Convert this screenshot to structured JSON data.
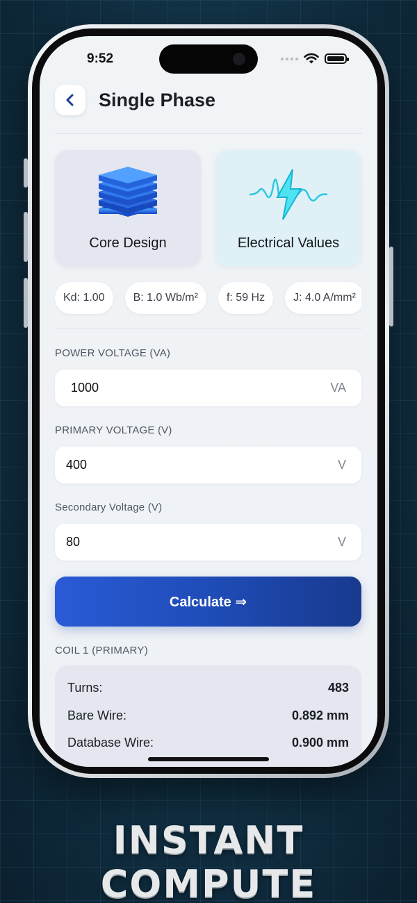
{
  "status": {
    "time": "9:52"
  },
  "header": {
    "title": "Single Phase",
    "back_icon": "chevron-left-icon"
  },
  "modes": [
    {
      "label": "Core Design",
      "icon": "core-stack-icon"
    },
    {
      "label": "Electrical Values",
      "icon": "lightning-wave-icon"
    }
  ],
  "chips": [
    "Kd: 1.00",
    "B: 1.0 Wb/m²",
    "f: 59 Hz",
    "J: 4.0 A/mm²"
  ],
  "fields": {
    "power": {
      "label": "POWER VOLTAGE (VA)",
      "value": "1000",
      "unit": "VA"
    },
    "primary": {
      "label": "PRIMARY VOLTAGE (V)",
      "value": "400",
      "unit": "V"
    },
    "secondary": {
      "label": "Secondary Voltage (V)",
      "value": "80",
      "unit": "V"
    }
  },
  "calculate_label": "Calculate ⇒",
  "results": {
    "title": "COIL 1 (PRIMARY)",
    "rows": [
      {
        "label": "Turns:",
        "value": "483"
      },
      {
        "label": "Bare Wire:",
        "value": "0.892 mm"
      },
      {
        "label": "Database Wire:",
        "value": "0.900 mm"
      }
    ]
  },
  "tagline": "INSTANT COMPUTE",
  "colors": {
    "accent": "#2a5bd6",
    "background": "#123448"
  }
}
